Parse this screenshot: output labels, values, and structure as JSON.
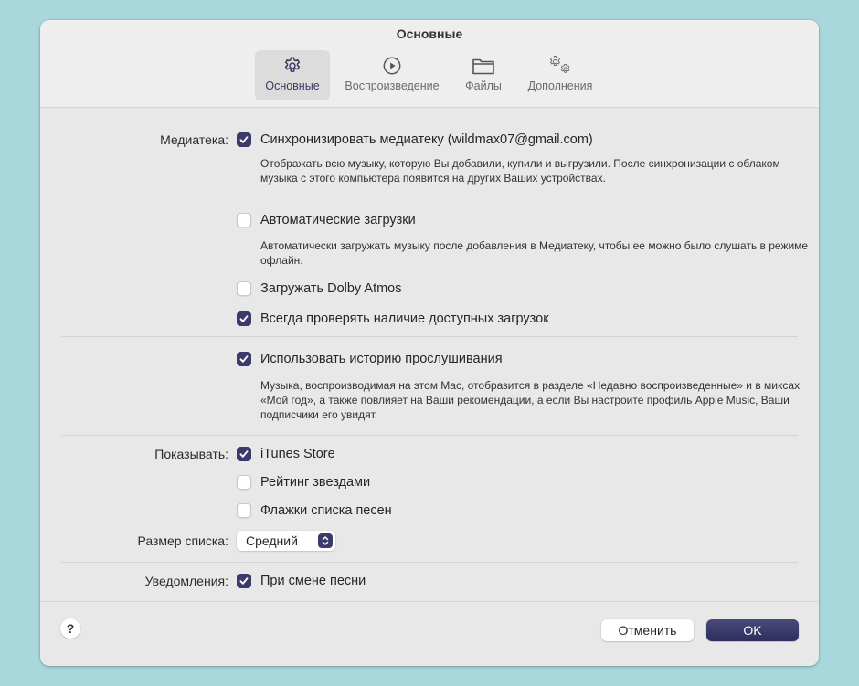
{
  "window": {
    "title": "Основные"
  },
  "tabs": [
    {
      "label": "Основные",
      "icon": "gear-icon",
      "selected": true
    },
    {
      "label": "Воспроизведение",
      "icon": "play-circle-icon",
      "selected": false
    },
    {
      "label": "Файлы",
      "icon": "folder-icon",
      "selected": false
    },
    {
      "label": "Дополнения",
      "icon": "gears-icon",
      "selected": false
    }
  ],
  "library": {
    "label": "Медиатека:",
    "sync": {
      "label": "Синхронизировать медиатеку (wildmax07@gmail.com)",
      "checked": true,
      "description": "Отображать всю музыку, которую Вы добавили, купили и выгрузили. После синхронизации с облаком музыка с этого компьютера появится на других Ваших устройствах."
    },
    "auto_downloads": {
      "label": "Автоматические загрузки",
      "checked": false,
      "description": "Автоматически загружать музыку после добавления в Медиатеку, чтобы ее можно было слушать в режиме офлайн."
    },
    "dolby": {
      "label": "Загружать Dolby Atmos",
      "checked": false
    },
    "check_downloads": {
      "label": "Всегда проверять наличие доступных загрузок",
      "checked": true
    }
  },
  "history": {
    "label": "Использовать историю прослушивания",
    "checked": true,
    "description": "Музыка, воспроизводимая на этом Mac, отобразится в разделе «Недавно воспроизведенные» и в миксах «Мой год», а также повлияет на Ваши рекомендации, а если Вы настроите профиль Apple Music, Ваши подписчики его увидят."
  },
  "show": {
    "label": "Показывать:",
    "itunes": {
      "label": "iTunes Store",
      "checked": true
    },
    "stars": {
      "label": "Рейтинг звездами",
      "checked": false
    },
    "flags": {
      "label": "Флажки списка песен",
      "checked": false
    }
  },
  "list_size": {
    "label": "Размер списка:",
    "value": "Средний"
  },
  "notifications": {
    "label": "Уведомления:",
    "song_change": {
      "label": "При смене песни",
      "checked": true
    }
  },
  "footer": {
    "help": "?",
    "cancel": "Отменить",
    "ok": "OK"
  },
  "colors": {
    "accent": "#3b3a6b",
    "background": "#a8d8dc",
    "window": "#e8e8e9"
  }
}
